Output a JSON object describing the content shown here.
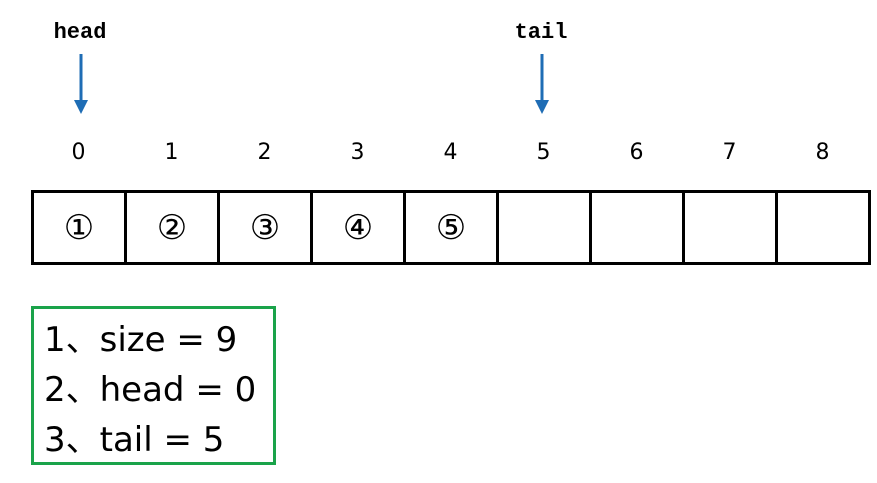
{
  "pointers": {
    "head": {
      "label": "head",
      "index": 0
    },
    "tail": {
      "label": "tail",
      "index": 5
    }
  },
  "indices": [
    "0",
    "1",
    "2",
    "3",
    "4",
    "5",
    "6",
    "7",
    "8"
  ],
  "cells": [
    "①",
    "②",
    "③",
    "④",
    "⑤",
    "",
    "",
    "",
    ""
  ],
  "info": [
    "1、size = 9",
    "2、head = 0",
    "3、tail = 5"
  ],
  "colors": {
    "arrow": "#1f6db5",
    "box_border": "#1aa34a"
  }
}
